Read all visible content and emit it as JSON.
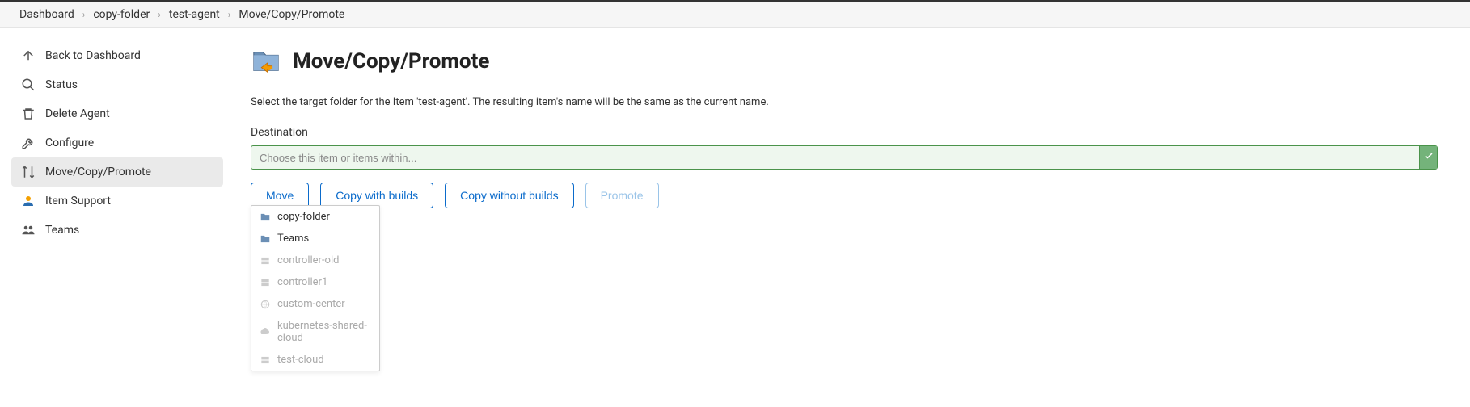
{
  "breadcrumb": [
    {
      "label": "Dashboard"
    },
    {
      "label": "copy-folder"
    },
    {
      "label": "test-agent"
    },
    {
      "label": "Move/Copy/Promote"
    }
  ],
  "sidebar": {
    "items": [
      {
        "label": "Back to Dashboard"
      },
      {
        "label": "Status"
      },
      {
        "label": "Delete Agent"
      },
      {
        "label": "Configure"
      },
      {
        "label": "Move/Copy/Promote"
      },
      {
        "label": "Item Support"
      },
      {
        "label": "Teams"
      }
    ]
  },
  "main": {
    "title": "Move/Copy/Promote",
    "description": "Select the target folder for the Item 'test-agent'. The resulting item's name will be the same as the current name.",
    "destination_label": "Destination",
    "combo_placeholder": "Choose this item or items within...",
    "buttons": {
      "move": "Move",
      "copy_with": "Copy with builds",
      "copy_without": "Copy without builds",
      "promote": "Promote"
    },
    "dropdown": [
      {
        "label": "copy-folder",
        "enabled": true,
        "icon": "folder"
      },
      {
        "label": "Teams",
        "enabled": true,
        "icon": "folder"
      },
      {
        "label": "controller-old",
        "enabled": false,
        "icon": "server"
      },
      {
        "label": "controller1",
        "enabled": false,
        "icon": "server"
      },
      {
        "label": "custom-center",
        "enabled": false,
        "icon": "globe"
      },
      {
        "label": "kubernetes-shared-cloud",
        "enabled": false,
        "icon": "cloud"
      },
      {
        "label": "test-cloud",
        "enabled": false,
        "icon": "server"
      }
    ]
  }
}
